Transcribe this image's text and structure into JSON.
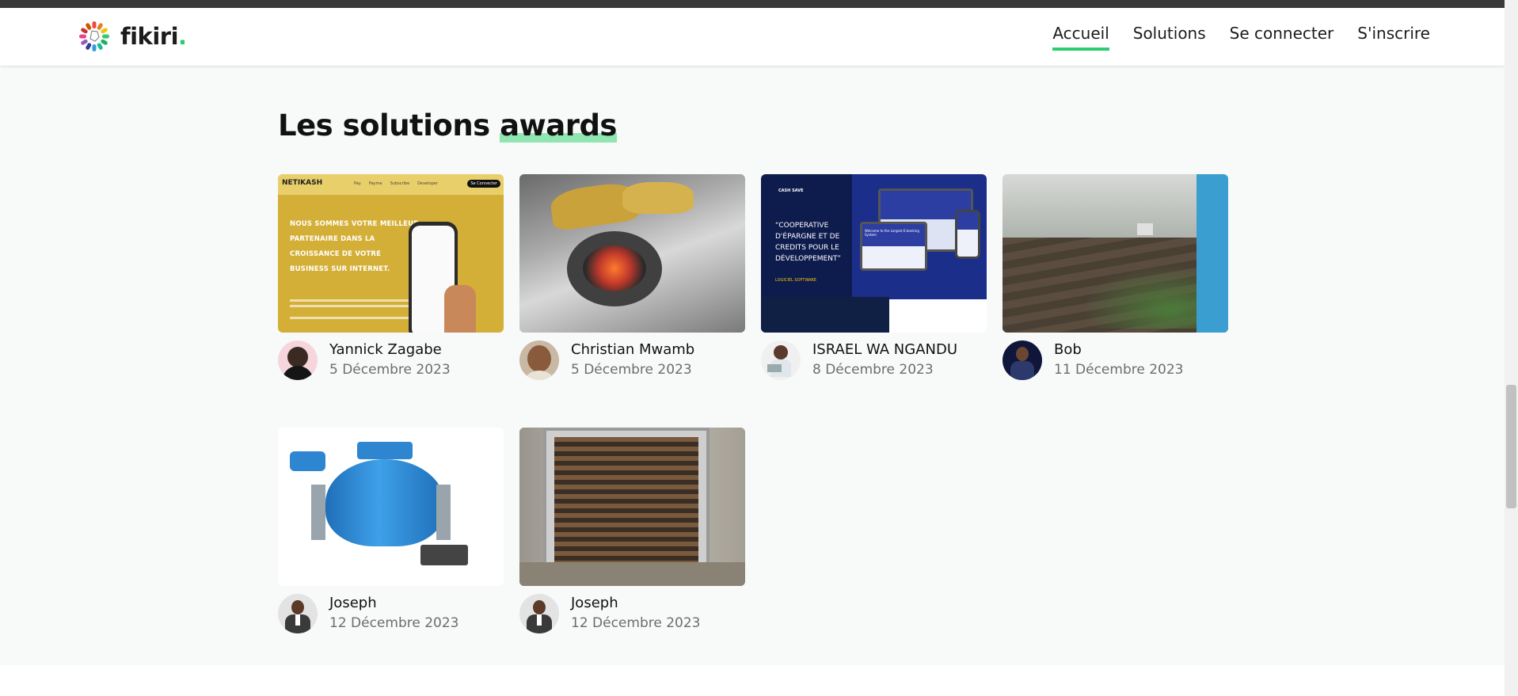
{
  "brand": {
    "name": "fikiri",
    "dot": "."
  },
  "nav": {
    "items": [
      "Accueil",
      "Solutions",
      "Se connecter",
      "S'inscrire"
    ],
    "active": "Accueil"
  },
  "section": {
    "title_main": "Les solutions ",
    "title_highlight": "awards"
  },
  "colors": {
    "accent": "#2ecc71",
    "highlight": "#8fe6b0"
  },
  "cards": [
    {
      "author": "Yannick Zagabe",
      "date": "5 Décembre 2023",
      "thumb": {
        "logo": "NETIKASH",
        "menu": [
          "Pay",
          "Payme",
          "Subscribe",
          "Developer"
        ],
        "login": "Se Connecter",
        "headline": [
          "NOUS SOMMES VOTRE MEILLEUR",
          "PARTENAIRE DANS LA",
          "CROISSANCE DE VOTRE",
          "BUSINESS SUR INTERNET."
        ]
      }
    },
    {
      "author": "Christian Mwamb",
      "date": "5 Décembre 2023"
    },
    {
      "author": "ISRAEL WA NGANDU",
      "date": "8 Décembre 2023",
      "thumb": {
        "brand": "CASH SAVE",
        "quote": [
          "“COOPERATIVE",
          "D'ÉPARGNE ET DE",
          "CREDITS POUR LE",
          "DÉVELOPPEMENT”"
        ],
        "tag": "LOGICIEL SOFTWARE",
        "screen_text": "Welcome to the Largest E-banking System"
      }
    },
    {
      "author": "Bob",
      "date": "11 Décembre 2023"
    },
    {
      "author": "Joseph",
      "date": "12 Décembre 2023"
    },
    {
      "author": "Joseph",
      "date": "12 Décembre 2023"
    }
  ]
}
